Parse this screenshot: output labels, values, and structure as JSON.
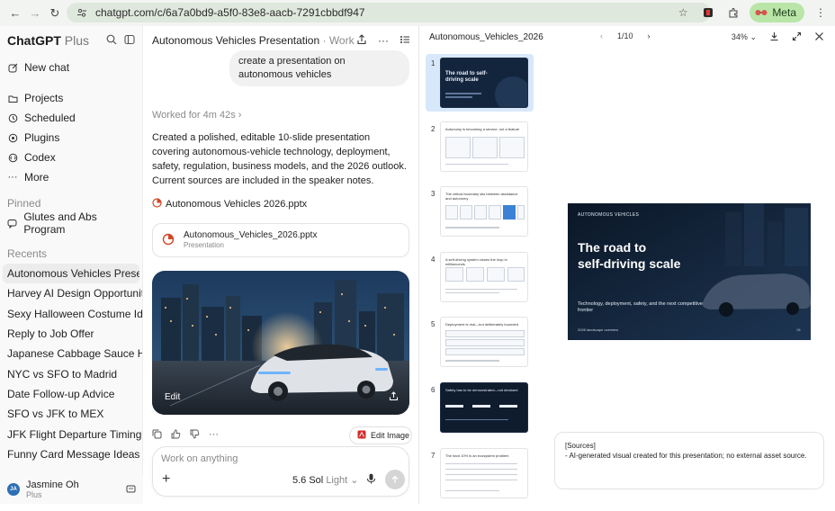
{
  "browser": {
    "url": "chatgpt.com/c/6a7a0bd9-a5f0-83e8-aacb-7291cbbdf947",
    "profile_label": "Meta"
  },
  "sidebar": {
    "brand": "ChatGPT",
    "plan": "Plus",
    "nav": [
      {
        "label": "New chat",
        "icon": "new-chat-icon"
      },
      {
        "label": "Projects",
        "icon": "folder-icon"
      },
      {
        "label": "Scheduled",
        "icon": "clock-icon"
      },
      {
        "label": "Plugins",
        "icon": "plugin-icon"
      },
      {
        "label": "Codex",
        "icon": "codex-icon"
      },
      {
        "label": "More",
        "icon": "more-icon"
      }
    ],
    "pinned_heading": "Pinned",
    "pinned": [
      {
        "label": "Glutes and Abs Program"
      }
    ],
    "recents_heading": "Recents",
    "recents": [
      {
        "label": "Autonomous Vehicles Presentation",
        "active": true
      },
      {
        "label": "Harvey AI Design Opportunity"
      },
      {
        "label": "Sexy Halloween Costume Ideas"
      },
      {
        "label": "Reply to Job Offer"
      },
      {
        "label": "Japanese Cabbage Sauce Help"
      },
      {
        "label": "NYC vs SFO to Madrid"
      },
      {
        "label": "Date Follow-up Advice"
      },
      {
        "label": "SFO vs JFK to MEX"
      },
      {
        "label": "JFK Flight Departure Timing"
      },
      {
        "label": "Funny Card Message Ideas"
      }
    ],
    "user": {
      "initials": "JA",
      "name": "Jasmine Oh",
      "plan": "Plus"
    }
  },
  "chat": {
    "title": "Autonomous Vehicles Presentation",
    "project": "Work",
    "user_message": "create a presentation on autonomous vehicles",
    "worked_for": "Worked for 4m 42s",
    "assistant_text": "Created a polished, editable 10-slide presentation covering autonomous-vehicle technology, deployment, safety, regulation, business models, and the 2026 outlook. Current sources are included in the speaker notes.",
    "file_link": "Autonomous Vehicles 2026.pptx",
    "file_card": {
      "name": "Autonomous_Vehicles_2026.pptx",
      "type": "Presentation"
    },
    "image_edit_label": "Edit",
    "edit_image_label": "Edit Image",
    "composer": {
      "placeholder": "Work on anything",
      "model": "5.6 Sol",
      "mode": "Light"
    }
  },
  "preview": {
    "title": "Autonomous_Vehicles_2026",
    "page": "1/10",
    "zoom": "34%",
    "thumbnails": [
      {
        "num": "1",
        "title": "The road to self-driving scale",
        "dark": true,
        "selected": true
      },
      {
        "num": "2",
        "title": "Autonomy is becoming a service, not a feature",
        "dark": false
      },
      {
        "num": "3",
        "title": "The critical boundary sits between assistance and autonomy",
        "dark": false
      },
      {
        "num": "4",
        "title": "A self-driving system closes the loop in milliseconds",
        "dark": false
      },
      {
        "num": "5",
        "title": "Deployment is real—but deliberately bounded",
        "dark": false
      },
      {
        "num": "6",
        "title": "Safety has to be demonstrated—not declared",
        "dark": true
      },
      {
        "num": "7",
        "title": "The hard 10% is an ecosystem problem",
        "dark": false
      }
    ],
    "slide": {
      "tag": "AUTONOMOUS VEHICLES",
      "title_line1": "The road to",
      "title_line2": "self-driving scale",
      "subtitle": "Technology, deployment, safety, and the next competitive frontier",
      "footer": "2026 landscape overview",
      "page_num": "01"
    },
    "sources": {
      "heading": "[Sources]",
      "line": "- AI-generated visual created for this presentation; no external asset source."
    }
  },
  "colors": {
    "accent": "#3b82d6",
    "slide_bg": "#0f1c2e",
    "meta_pill": "#b9e6a8"
  }
}
